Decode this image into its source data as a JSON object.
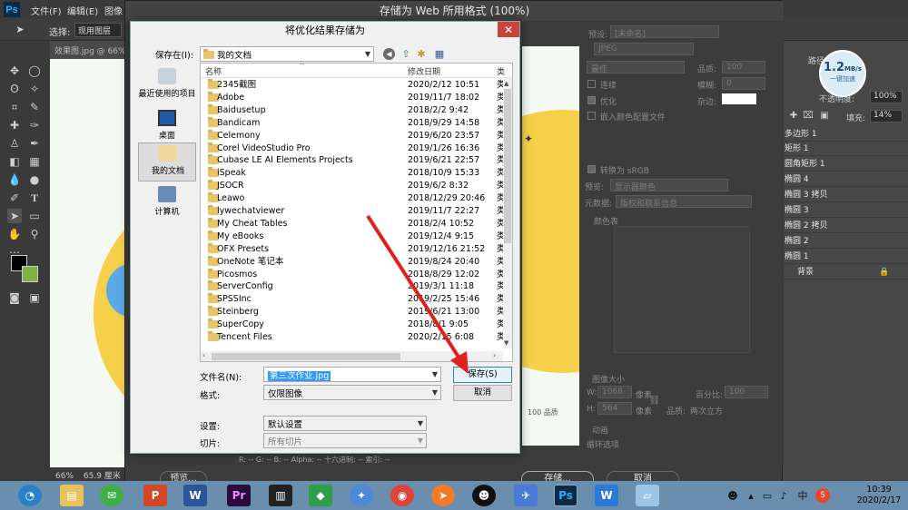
{
  "ps": {
    "menus": [
      "文件(F)",
      "编辑(E)",
      "图像"
    ],
    "options": {
      "select_label": "选择:",
      "select_value": "现用图层"
    },
    "doc_tab": "效果图.jpg @ 66%",
    "status": {
      "zoom": "66%",
      "size": "65.9 厘米"
    }
  },
  "sfw": {
    "title": "存储为 Web 所用格式 (100%)",
    "preset_label": "预设:",
    "preset_value": "[未命名]",
    "format_value": "JPEG",
    "quality_mode": "最佳",
    "quality_label": "品质:",
    "quality_value": "100",
    "progressive_label": "连续",
    "blur_label": "模糊:",
    "blur_value": "0",
    "optimized_label": "优化",
    "matte_label": "杂边:",
    "embed_profile_label": "嵌入颜色配置文件",
    "convert_srgb_label": "转换为 sRGB",
    "preview_label": "预览:",
    "preview_value": "显示器颜色",
    "metadata_label": "元数据:",
    "metadata_value": "版权和联系信息",
    "color_table_label": "颜色表",
    "image_size_label": "图像大小",
    "w_label": "W:",
    "w_value": "1068",
    "h_label": "H:",
    "h_value": "564",
    "px_label": "像素",
    "percent_label": "百分比:",
    "percent_value": "100",
    "quality2_label": "品质:",
    "quality2_value": "两次立方",
    "animation_label": "动画",
    "loop_label": "循环选项",
    "preview_quality": "100 品质",
    "bottom_readout": "R: --  G: --  B: --  Alpha: --  十六进制: --  索引: --",
    "preview_button": "预览...",
    "save_button": "存储...",
    "cancel_button": "取消"
  },
  "dialog": {
    "title": "将优化结果存储为",
    "save_in_label": "保存在(I):",
    "save_in_value": "我的文档",
    "places": [
      "最近使用的项目",
      "桌面",
      "我的文档",
      "计算机"
    ],
    "col_name": "名称",
    "col_date": "修改日期",
    "col_type": "类",
    "files": [
      {
        "name": "2345截图",
        "date": "2020/2/12 10:51"
      },
      {
        "name": "Adobe",
        "date": "2019/11/7 18:02"
      },
      {
        "name": "Baidusetup",
        "date": "2018/2/2 9:42"
      },
      {
        "name": "Bandicam",
        "date": "2018/9/29 14:58"
      },
      {
        "name": "Celemony",
        "date": "2019/6/20 23:57"
      },
      {
        "name": "Corel VideoStudio Pro",
        "date": "2019/1/26 16:36"
      },
      {
        "name": "Cubase LE AI Elements Projects",
        "date": "2019/6/21 22:57"
      },
      {
        "name": "iSpeak",
        "date": "2018/10/9 15:33"
      },
      {
        "name": "JSOCR",
        "date": "2019/6/2 8:32"
      },
      {
        "name": "Leawo",
        "date": "2018/12/29 20:46"
      },
      {
        "name": "lywechatviewer",
        "date": "2019/11/7 22:27"
      },
      {
        "name": "My Cheat Tables",
        "date": "2018/2/4 10:52"
      },
      {
        "name": "My eBooks",
        "date": "2019/12/4 9:15"
      },
      {
        "name": "OFX Presets",
        "date": "2019/12/16 21:52"
      },
      {
        "name": "OneNote 笔记本",
        "date": "2019/8/24 20:40"
      },
      {
        "name": "Picosmos",
        "date": "2018/8/29 12:02"
      },
      {
        "name": "ServerConfig",
        "date": "2019/3/1 11:18"
      },
      {
        "name": "SPSSInc",
        "date": "2019/2/25 15:46"
      },
      {
        "name": "Steinberg",
        "date": "2019/6/21 13:00"
      },
      {
        "name": "SuperCopy",
        "date": "2018/8/1 9:05"
      },
      {
        "name": "Tencent Files",
        "date": "2020/2/15 6:08"
      }
    ],
    "filename_label": "文件名(N):",
    "filename_value": "第三次作业.jpg",
    "format_label": "格式:",
    "format_value": "仅限图像",
    "save_button": "保存(S)",
    "cancel_button": "取消",
    "settings_label": "设置:",
    "settings_value": "默认设置",
    "slices_label": "切片:",
    "slices_value": "所有切片"
  },
  "layers": {
    "opacity_label": "不透明度:",
    "opacity_value": "100%",
    "fill_label": "填充:",
    "fill_value": "14%",
    "items": [
      "多边形 1",
      "矩形 1",
      "圆角矩形 1",
      "椭圆 4",
      "椭圆 3 拷贝",
      "椭圆 3",
      "椭圆 2 拷贝",
      "椭圆 2",
      "椭圆 1",
      "背景"
    ],
    "tab_label": "路径"
  },
  "speed": {
    "value": "1.2",
    "unit": "MB/s",
    "label": "一键加速"
  },
  "taskbar": {
    "time": "10:39",
    "date": "2020/2/17",
    "input_label": "中"
  },
  "colors": {
    "accent_arrow": "#e0201a",
    "fg_swatch": "#000000",
    "bg_swatch": "#7cb342",
    "yellow": "#f6d049",
    "taskbar": "#6a8fae"
  }
}
